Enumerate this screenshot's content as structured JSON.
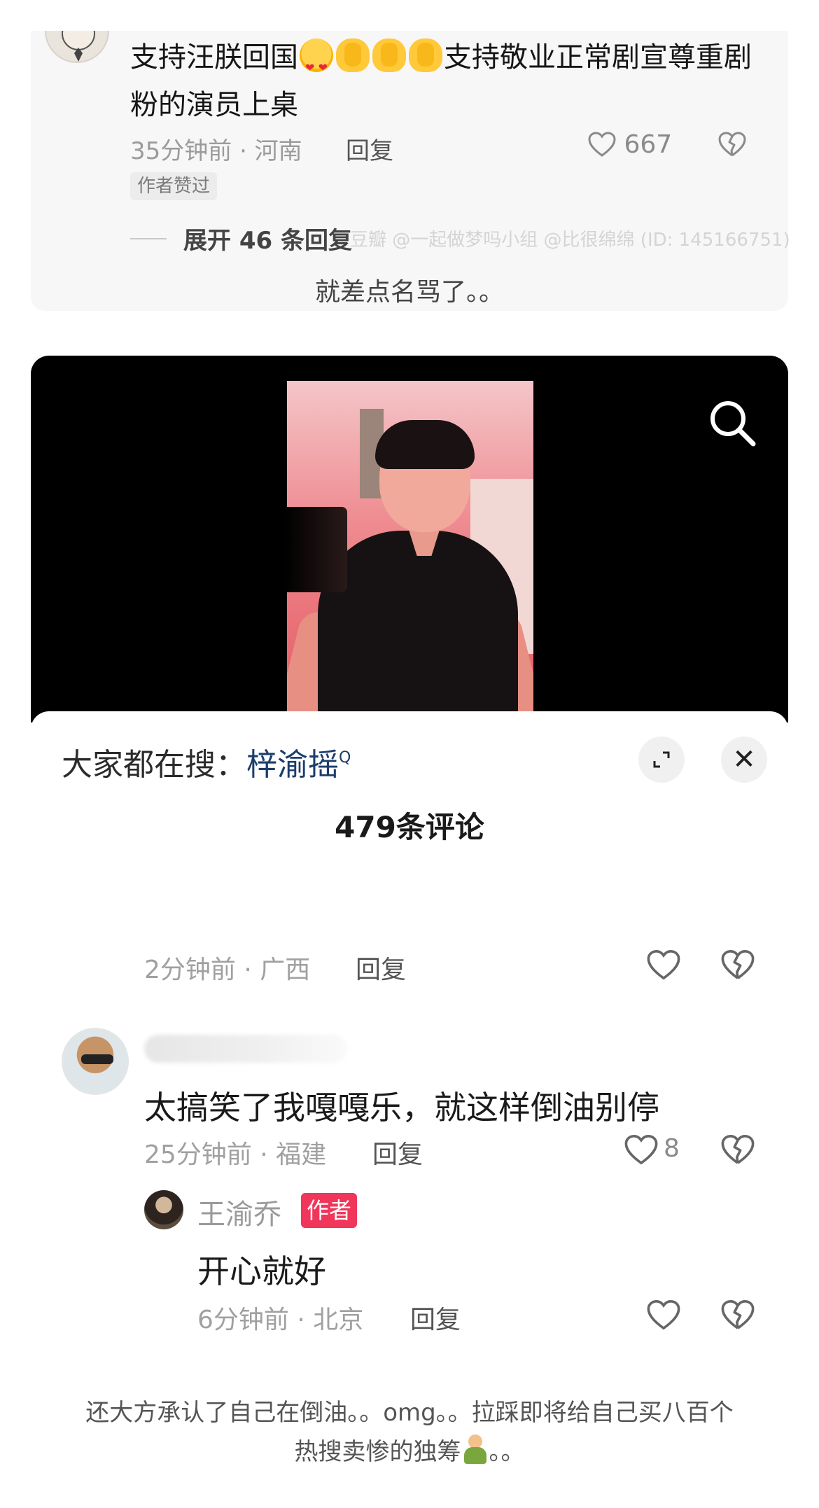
{
  "top_comment": {
    "text_before_emoji": "支持汪朕回国",
    "text_after_emoji": "支持敬业正常剧宣尊重剧粉的演员上桌",
    "emojis": [
      "heart-eyes-emoji",
      "clap-emoji",
      "clap-emoji",
      "clap-emoji"
    ],
    "meta": "35分钟前 · 河南",
    "reply_label": "回复",
    "like_count": "667",
    "badge": "作者赞过",
    "expand_label": "展开 46 条回复"
  },
  "watermark": "豆瓣 @一起做梦吗小组 @比很绵绵 (ID: 145166751)",
  "caption_top": "就差点名骂了。。",
  "panel": {
    "hot_search_prefix": "大家都在搜：",
    "hot_search_keyword": "梓渝摇",
    "hot_search_sup": "Q",
    "count_title": "479条评论",
    "close_glyph": "✕"
  },
  "comments": [
    {
      "meta": "2分钟前 · 广西",
      "reply_label": "回复",
      "like_count": ""
    },
    {
      "text": "太搞笑了我嘎嘎乐，就这样倒油别停",
      "meta": "25分钟前 · 福建",
      "reply_label": "回复",
      "like_count": "8"
    },
    {
      "author_name": "王渝乔",
      "author_badge": "作者",
      "text": "开心就好",
      "meta": "6分钟前 · 北京",
      "reply_label": "回复",
      "like_count": ""
    }
  ],
  "caption_bottom_line1": "还大方承认了自己在倒油。。omg。。拉踩即将给自己买八百个",
  "caption_bottom_line2_a": "热搜卖惨的独筹",
  "caption_bottom_line2_b": "。。",
  "colors": {
    "author_badge_bg": "#f0365b",
    "hot_search_keyword": "#1c3d6b",
    "video_bg": "#000000"
  }
}
